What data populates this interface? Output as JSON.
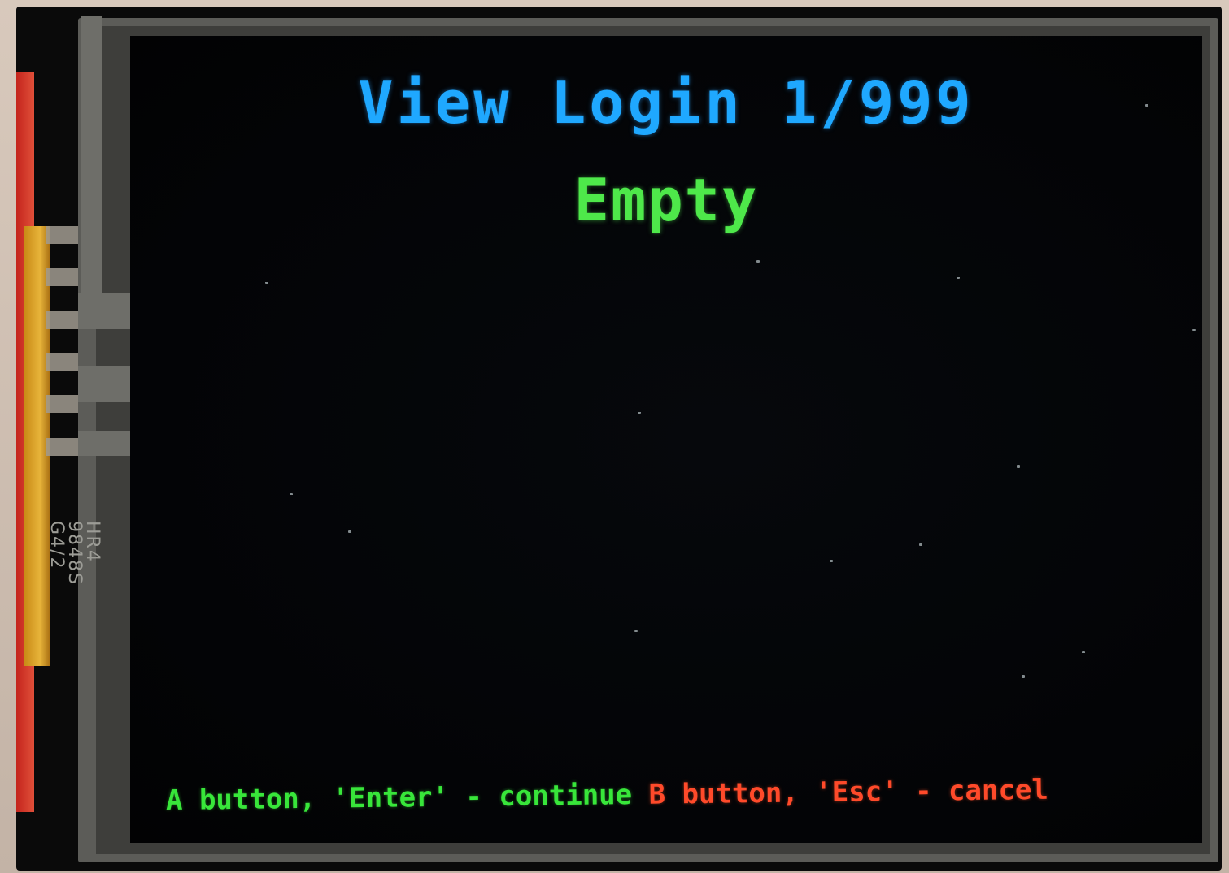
{
  "device": {
    "silkscreen": [
      "HR4",
      "9848S",
      "G4/2"
    ]
  },
  "screen": {
    "title": "View Login 1/999",
    "status": "Empty",
    "footer": {
      "continue_hint": "A button, 'Enter' - continue",
      "cancel_hint": "B button, 'Esc' - cancel"
    }
  },
  "colors": {
    "title": "#1fa8ff",
    "status": "#4ee84a",
    "continue": "#38e63a",
    "cancel": "#ff4a2a",
    "background": "#030406"
  }
}
